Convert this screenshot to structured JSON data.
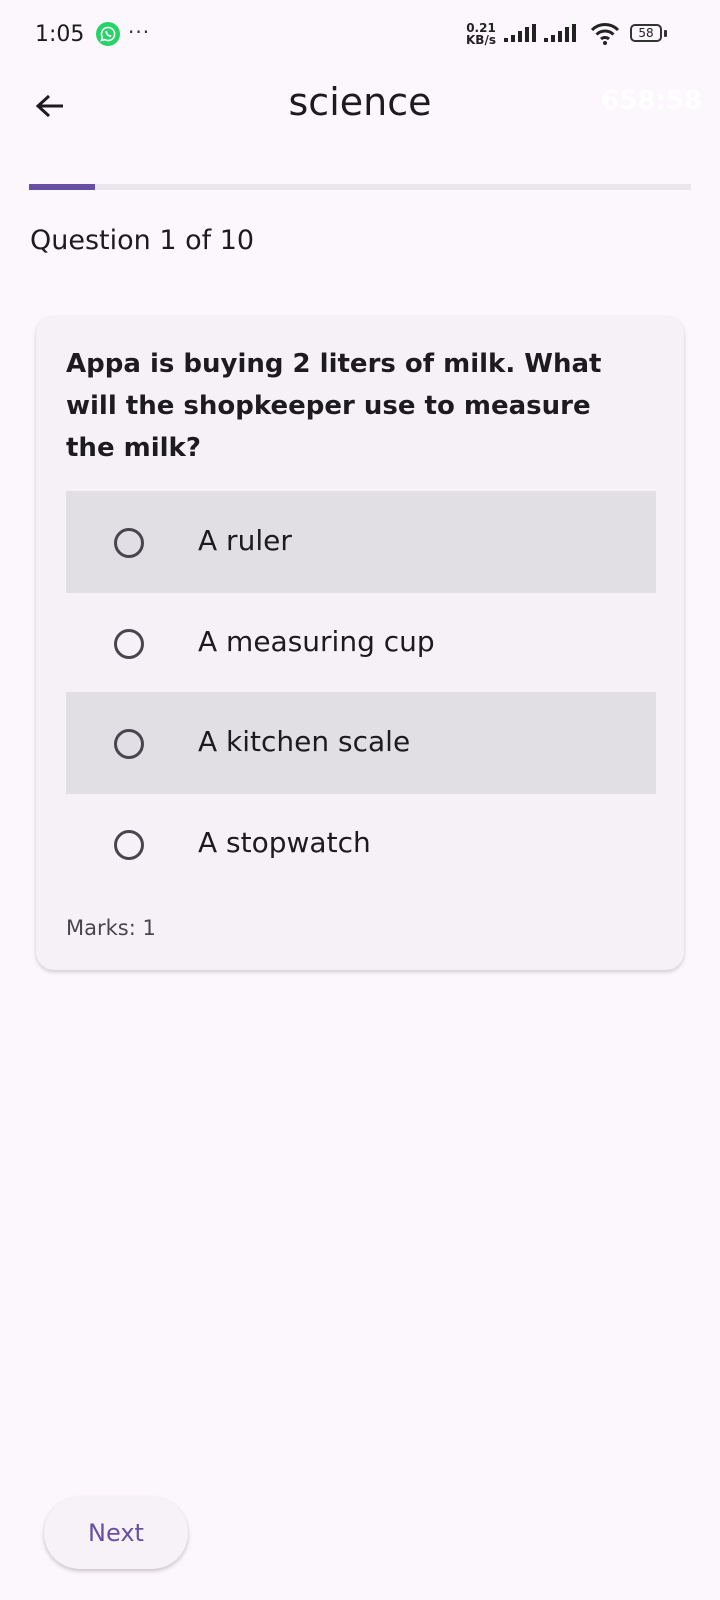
{
  "status_bar": {
    "time": "1:05",
    "overflow": "···",
    "net_speed_value": "0.21",
    "net_speed_unit": "KB/s",
    "battery": "58"
  },
  "app_bar": {
    "title": "science",
    "timer": "658:58"
  },
  "progress": {
    "fraction": 0.1,
    "label": "Question 1 of 10"
  },
  "question": {
    "text": "Appa is buying 2 liters of milk. What will the shopkeeper use to measure the milk?",
    "options": [
      {
        "label": "A ruler"
      },
      {
        "label": "A measuring cup"
      },
      {
        "label": "A kitchen scale"
      },
      {
        "label": "A stopwatch"
      }
    ],
    "marks": "Marks: 1"
  },
  "footer": {
    "next_label": "Next"
  },
  "colors": {
    "accent": "#6750a4",
    "background": "#fcf7fc",
    "card": "#f5f1f6"
  }
}
